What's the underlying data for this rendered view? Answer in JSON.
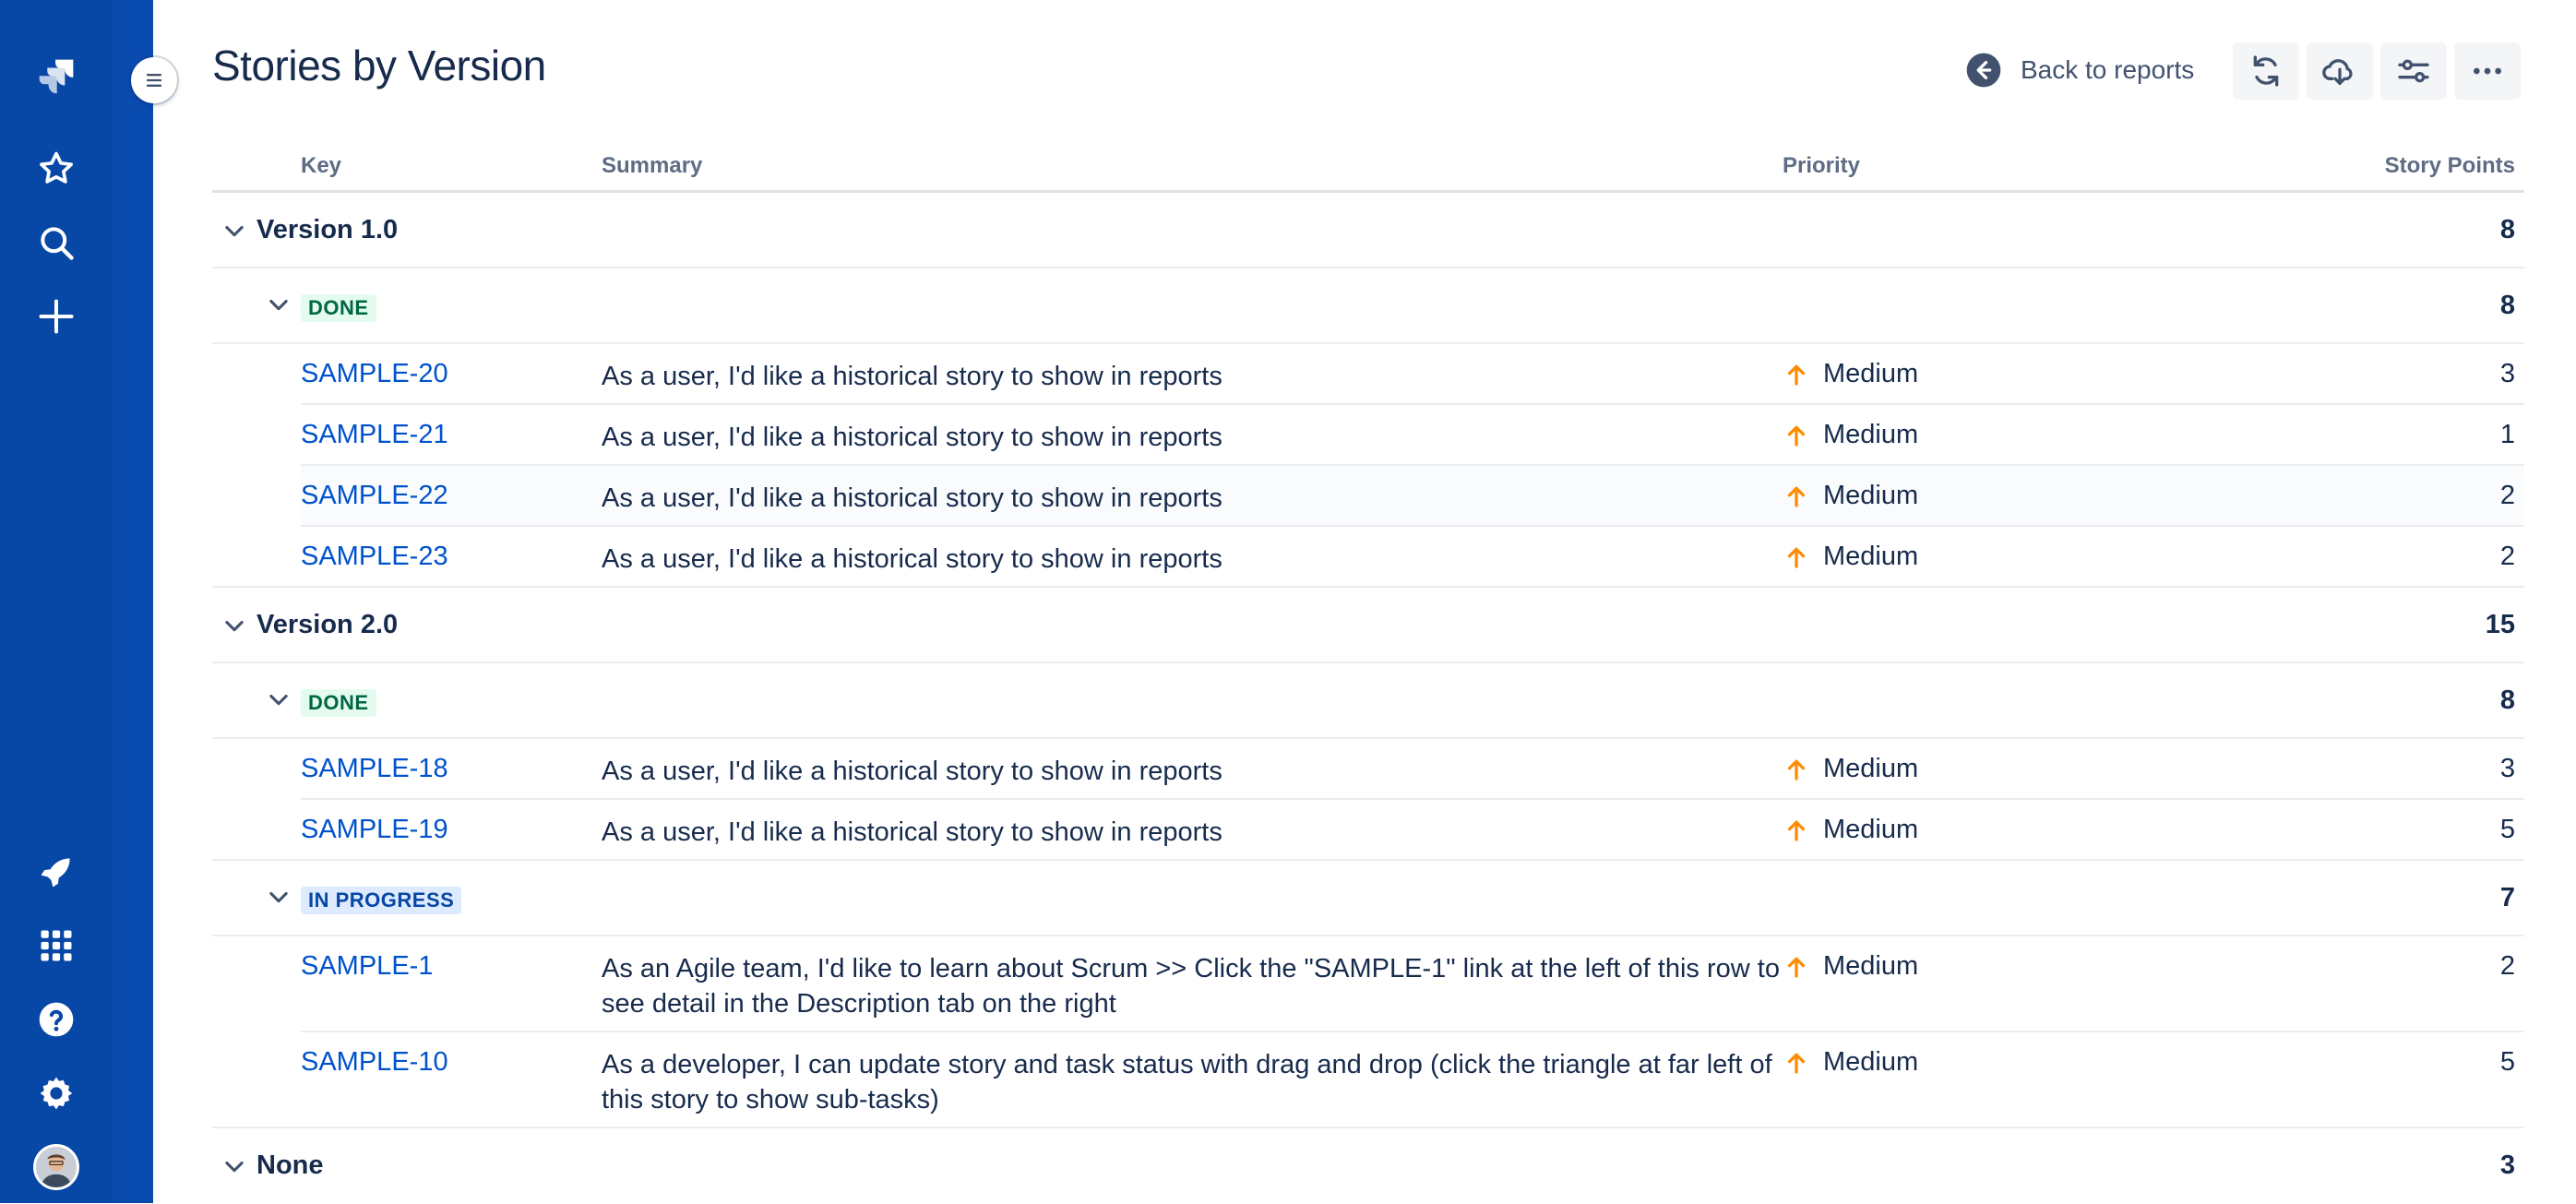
{
  "page": {
    "title": "Stories by Version",
    "back_label": "Back to reports"
  },
  "colors": {
    "sidebar": "#0747a6",
    "link": "#0052cc",
    "priority_medium": "#ff8b00",
    "done_bg": "#e3fcef",
    "done_text": "#006644",
    "inprogress_bg": "#deebff",
    "inprogress_text": "#0747a6"
  },
  "sidebar": {
    "icons": [
      "jira-logo-icon",
      "star-icon",
      "search-icon",
      "plus-icon",
      "rocket-icon",
      "app-grid-icon",
      "help-icon",
      "gear-icon",
      "avatar"
    ]
  },
  "toolbar": {
    "icons": [
      "refresh-icon",
      "cloud-download-icon",
      "filter-settings-icon",
      "more-icon"
    ]
  },
  "table": {
    "headers": {
      "key": "Key",
      "summary": "Summary",
      "priority": "Priority",
      "points": "Story Points"
    },
    "versions": [
      {
        "name": "Version 1.0",
        "total": "8",
        "groups": [
          {
            "status": "DONE",
            "total": "8",
            "issues": [
              {
                "key": "SAMPLE-20",
                "summary": "As a user, I'd like a historical story to show in reports",
                "priority": "Medium",
                "points": "3"
              },
              {
                "key": "SAMPLE-21",
                "summary": "As a user, I'd like a historical story to show in reports",
                "priority": "Medium",
                "points": "1"
              },
              {
                "key": "SAMPLE-22",
                "summary": "As a user, I'd like a historical story to show in reports",
                "priority": "Medium",
                "points": "2"
              },
              {
                "key": "SAMPLE-23",
                "summary": "As a user, I'd like a historical story to show in reports",
                "priority": "Medium",
                "points": "2"
              }
            ]
          }
        ]
      },
      {
        "name": "Version 2.0",
        "total": "15",
        "groups": [
          {
            "status": "DONE",
            "total": "8",
            "issues": [
              {
                "key": "SAMPLE-18",
                "summary": "As a user, I'd like a historical story to show in reports",
                "priority": "Medium",
                "points": "3"
              },
              {
                "key": "SAMPLE-19",
                "summary": "As a user, I'd like a historical story to show in reports",
                "priority": "Medium",
                "points": "5"
              }
            ]
          },
          {
            "status": "IN PROGRESS",
            "total": "7",
            "issues": [
              {
                "key": "SAMPLE-1",
                "summary": "As an Agile team, I'd like to learn about Scrum >> Click the \"SAMPLE-1\" link at the left of this row to see detail in the Description tab on the right",
                "priority": "Medium",
                "points": "2"
              },
              {
                "key": "SAMPLE-10",
                "summary": "As a developer, I can update story and task status with drag and drop (click the triangle at far left of this story to show sub-tasks)",
                "priority": "Medium",
                "points": "5"
              }
            ]
          }
        ]
      },
      {
        "name": "None",
        "total": "3",
        "groups": []
      }
    ]
  }
}
